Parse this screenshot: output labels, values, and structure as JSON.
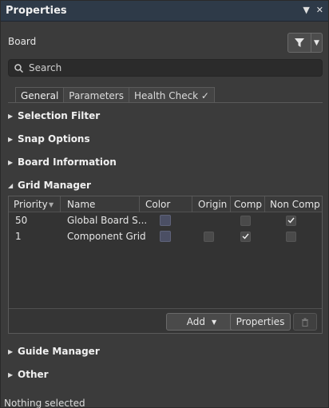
{
  "panel": {
    "title": "Properties",
    "pin_icon": "pin-icon",
    "close_icon": "close-icon"
  },
  "header": {
    "object": "Board"
  },
  "search": {
    "placeholder": "Search"
  },
  "tabs": [
    {
      "label": "General",
      "active": true
    },
    {
      "label": "Parameters",
      "active": false
    },
    {
      "label": "Health Check ✓",
      "active": false
    }
  ],
  "sections": {
    "selection_filter": "Selection Filter",
    "snap_options": "Snap Options",
    "board_information": "Board Information",
    "grid_manager": "Grid Manager",
    "guide_manager": "Guide Manager",
    "other": "Other"
  },
  "grid": {
    "columns": [
      "Priority",
      "Name",
      "Color",
      "Origin",
      "Comp",
      "Non Comp"
    ],
    "rows": [
      {
        "priority": "50",
        "name": "Global Board S...",
        "origin": false,
        "comp": false,
        "non_comp": true
      },
      {
        "priority": "1",
        "name": "Component Grid",
        "origin": false,
        "comp": true,
        "non_comp": false
      }
    ],
    "add_label": "Add",
    "properties_label": "Properties"
  },
  "status": {
    "text": "Nothing selected"
  }
}
